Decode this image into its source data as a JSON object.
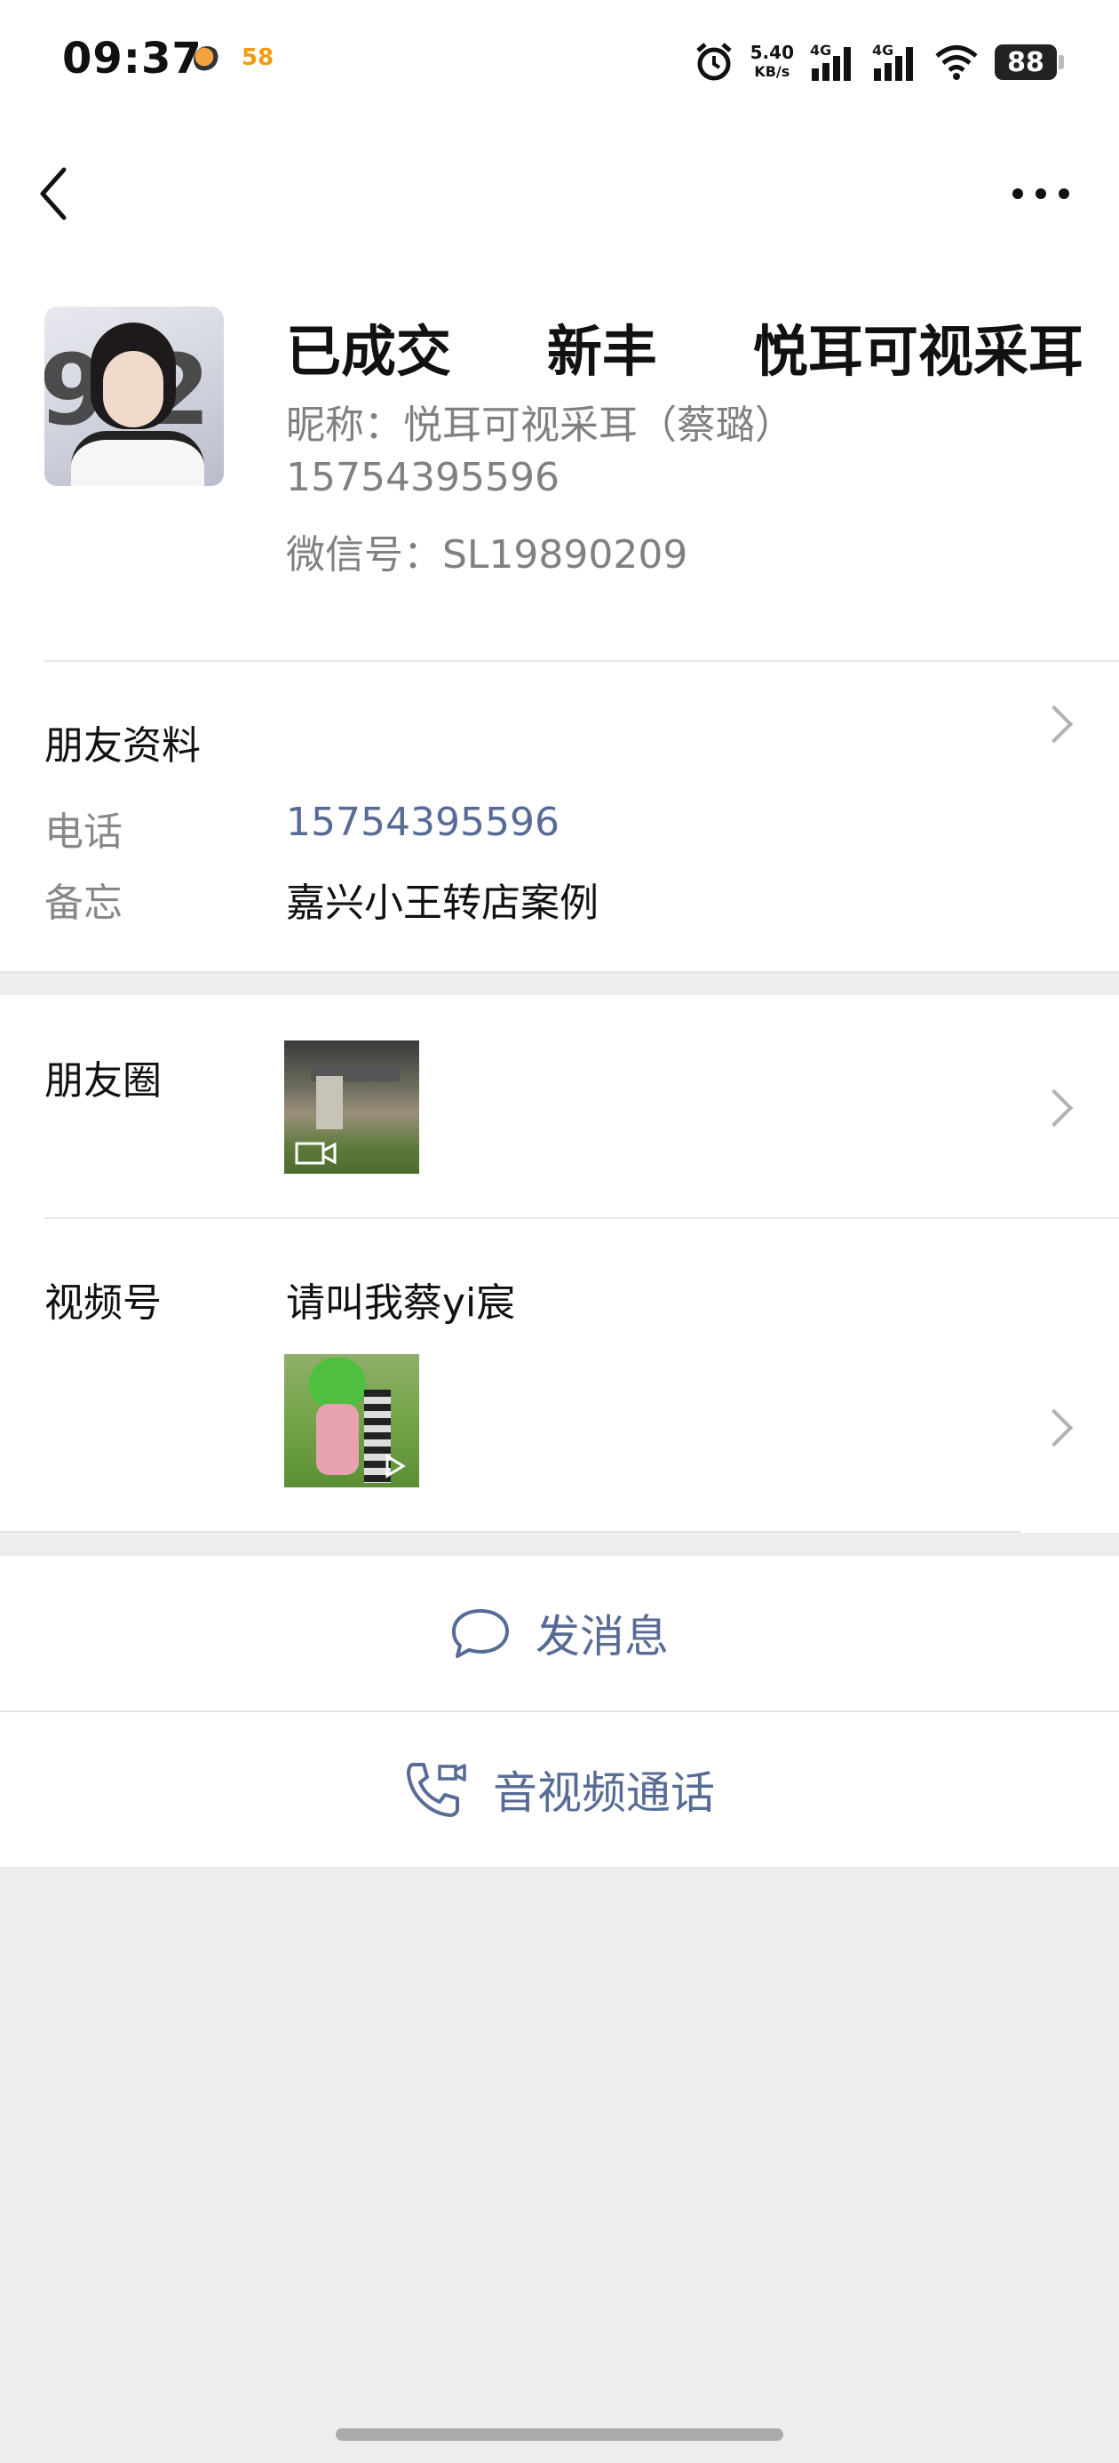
{
  "status_bar": {
    "time": "09:37",
    "net_speed_value": "5.40",
    "net_speed_unit": "KB/s",
    "signal_1": "4G",
    "signal_2": "4G",
    "battery": "88",
    "app_badge": "58"
  },
  "nav": {
    "back_icon": "chevron-left-icon",
    "more_icon": "ellipsis-icon"
  },
  "profile": {
    "remark_name": "已成交     新丰     悦耳可视采耳",
    "nickname": "昵称：悦耳可视采耳（蔡璐）",
    "phone": "15754395596",
    "wechat_id": "微信号：SL19890209",
    "avatar_text": "92"
  },
  "friend_info": {
    "title": "朋友资料",
    "phone_label": "电话",
    "phone_value": "15754395596",
    "memo_label": "备忘",
    "memo_value": "嘉兴小王转店案例"
  },
  "moments": {
    "label": "朋友圈"
  },
  "channels": {
    "label": "视频号",
    "name": "请叫我蔡yi宸"
  },
  "actions": {
    "message": "发消息",
    "call": "音视频通话"
  },
  "colors": {
    "link": "#576b95",
    "background": "#ededed",
    "card": "#ffffff"
  }
}
